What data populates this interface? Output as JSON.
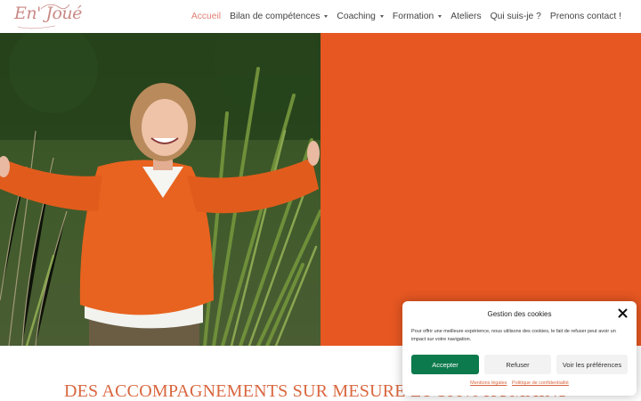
{
  "brand": {
    "logo_text": "En' Joué",
    "tagline": "",
    "logo_color": "#c98a86"
  },
  "nav": {
    "items": [
      {
        "label": "Accueil",
        "active": true,
        "dropdown": false
      },
      {
        "label": "Bilan de compétences",
        "active": false,
        "dropdown": true
      },
      {
        "label": "Coaching",
        "active": false,
        "dropdown": true
      },
      {
        "label": "Formation",
        "active": false,
        "dropdown": true
      },
      {
        "label": "Ateliers",
        "active": false,
        "dropdown": false
      },
      {
        "label": "Qui suis-je ?",
        "active": false,
        "dropdown": false
      },
      {
        "label": "Prenons contact !",
        "active": false,
        "dropdown": false
      }
    ],
    "active_color": "#e17f74"
  },
  "hero": {
    "panel_color": "#e65722",
    "photo_subject": "woman-orange-sweater-arms-raised"
  },
  "headline": {
    "text": "DES ACCOMPAGNEMENTS SUR MESURE ET 100% HUMAINS"
  },
  "cookie": {
    "title": "Gestion des cookies",
    "text": "Pour offrir une meilleure expérience, nous utilisons des cookies, le fait de refuser peut avoir un impact sur votre navigation.",
    "accept_label": "Accepter",
    "refuse_label": "Refuser",
    "prefs_label": "Voir les préférences",
    "link_legal": "Mentions légales",
    "link_privacy": "Politique de confidentialité",
    "accept_color": "#0c7a4c",
    "link_color": "#d9673f"
  }
}
